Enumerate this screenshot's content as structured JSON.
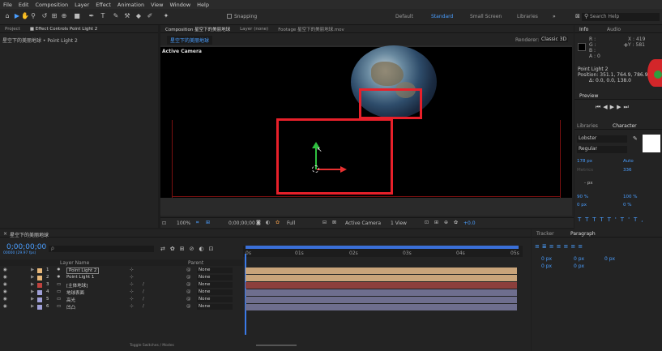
{
  "menu": [
    "File",
    "Edit",
    "Composition",
    "Layer",
    "Effect",
    "Animation",
    "View",
    "Window",
    "Help"
  ],
  "toolbar": {
    "snapping": "Snapping",
    "workspaces": [
      "Default",
      "Standard",
      "Small Screen",
      "Libraries"
    ],
    "active_workspace": "Standard",
    "search_placeholder": "Search Help"
  },
  "project_panel": {
    "tabs": [
      "Project",
      "Effect Controls Point Light 2"
    ],
    "breadcrumb": "星空下的美丽地球 • Point Light 2"
  },
  "comp_panel": {
    "tabs": [
      "Composition 星空下的美丽地球",
      "Layer (none)",
      "Footage 星空下的美丽地球.mov"
    ],
    "comp_tab": "星空下的美丽地球",
    "renderer_label": "Renderer:",
    "renderer_value": "Classic 3D",
    "camera_label": "Active Camera",
    "bottom": {
      "zoom": "100%",
      "timecode": "0;00;00;00",
      "quality": "Full",
      "view": "Active Camera",
      "views": "1 View",
      "exposure": "+0.0"
    }
  },
  "info_panel": {
    "tabs": [
      "Info",
      "Audio"
    ],
    "rgb": [
      "R :",
      "G :",
      "B :",
      "A : 0"
    ],
    "x": "X : 419",
    "y": "Y : 581",
    "layer": "Point Light 2",
    "position": "Position: 351.1, 764.9, 786.9",
    "delta": "Δ: 0.0, 0.0, 138.0"
  },
  "preview_panel": {
    "title": "Preview"
  },
  "character_panel": {
    "tabs": [
      "Libraries",
      "Character"
    ],
    "font": "Lobster",
    "style": "Regular",
    "size": "178 px",
    "leading": "Auto",
    "kerning": "Metrics",
    "tracking": "336",
    "stroke": "- px",
    "vscale": "90 %",
    "hscale": "100 %",
    "baseline": "0 px",
    "tsume": "0 %"
  },
  "tracker_panel": {
    "tabs": [
      "Tracker",
      "Paragraph"
    ],
    "values": [
      "0 px",
      "0 px",
      "0 px",
      "0 px",
      "0 px"
    ]
  },
  "timeline": {
    "tab": "星空下的美丽地球",
    "timecode": "0;00;00;00",
    "frame_info": "00000 (29.97 fps)",
    "search_placeholder": "ρ",
    "col_layer_name": "Layer Name",
    "col_parent": "Parent",
    "ruler": [
      "0s",
      "01s",
      "02s",
      "03s",
      "04s",
      "05s"
    ],
    "toggle_label": "Toggle Switches / Modes",
    "layers": [
      {
        "num": "1",
        "name": "Point Light 2",
        "color": "#e8b87a",
        "parent": "None",
        "bar": "#c9a47a"
      },
      {
        "num": "2",
        "name": "Point Light 1",
        "color": "#e8b87a",
        "parent": "None",
        "bar": "#c9a47a"
      },
      {
        "num": "3",
        "name": "[主体地球]",
        "color": "#c0433f",
        "parent": "None",
        "bar": "#8c3f3c"
      },
      {
        "num": "4",
        "name": "地球表面",
        "color": "#a0a0d8",
        "parent": "None",
        "bar": "#6e6e8e"
      },
      {
        "num": "5",
        "name": "高光",
        "color": "#a0a0d8",
        "parent": "None",
        "bar": "#6e6e8e"
      },
      {
        "num": "6",
        "name": "凹凸",
        "color": "#a0a0d8",
        "parent": "None",
        "bar": "#6e6e8e"
      }
    ]
  }
}
